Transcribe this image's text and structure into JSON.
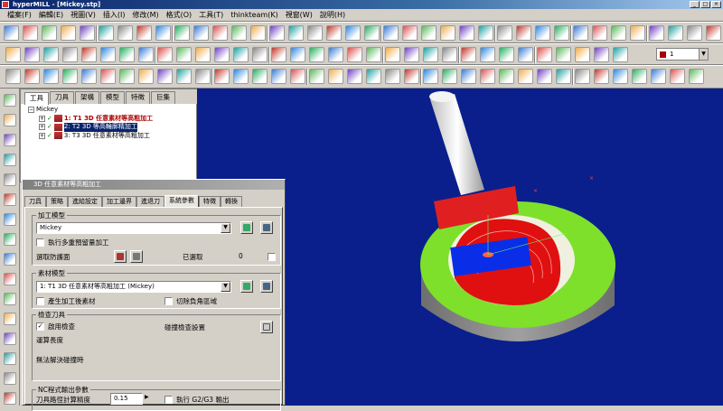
{
  "window": {
    "title": "hyperMILL - [Mickey.stp]"
  },
  "menu": [
    "檔案(F)",
    "編輯(E)",
    "視圖(V)",
    "插入(I)",
    "修改(M)",
    "格式(O)",
    "工具(T)",
    "thinkteam(K)",
    "視窗(W)",
    "說明(H)"
  ],
  "toolbar": {
    "layer_value": "1"
  },
  "browser": {
    "tabs": [
      "工具",
      "刀具",
      "架構",
      "模型",
      "特徵",
      "巨集"
    ],
    "active_tab": 0,
    "root": "Mickey",
    "jobs": [
      {
        "label": "1: T1 3D 任意素材等高粗加工",
        "state": "active"
      },
      {
        "label": "2: T2 3D 等高輪廓精加工",
        "state": "selected"
      },
      {
        "label": "3: T3 3D 任意素材等高粗加工",
        "state": "normal"
      }
    ]
  },
  "dialog": {
    "title": "3D 任意素材等高粗加工",
    "tabs": [
      "刀具",
      "策略",
      "進給設定",
      "加工邊界",
      "進退刀",
      "系統參數",
      "特徵",
      "轉換"
    ],
    "active_tab": 5,
    "machining_model": {
      "legend": "加工模型",
      "model_value": "Mickey",
      "multi_allowance": "執行多重預留量加工",
      "surface_selection": "選取防護面",
      "selected_label": "已選取",
      "selected_count": "0"
    },
    "stock_model": {
      "legend": "素材模型",
      "stock_value": "1: T1 3D 任意素材等高粗加工 (Mickey)",
      "generate_stock": "產生加工後素材",
      "cut_uncut": "切除負角區域"
    },
    "check_tool": {
      "legend": "檢查刀具",
      "enable_check": "啟用檢查",
      "tolerance_setting": "碰撞檢查設置",
      "calc_length": "運算長度",
      "unresolved": "無法解決碰撞時"
    },
    "nc_params": {
      "legend": "NC程式輸出參數",
      "path_tolerance": "刀具路徑計算精度",
      "path_tolerance_value": "0.15",
      "g2g3": "執行 G2/G3 輸出"
    }
  },
  "viewport": {
    "background": "#0a1f8c",
    "base_color": "#8a8a8a",
    "green": "#7ee02a",
    "red": "#e01010",
    "blue": "#0a2ee8",
    "tool_color": "#e8e8e8",
    "holder_color": "#e02020"
  }
}
